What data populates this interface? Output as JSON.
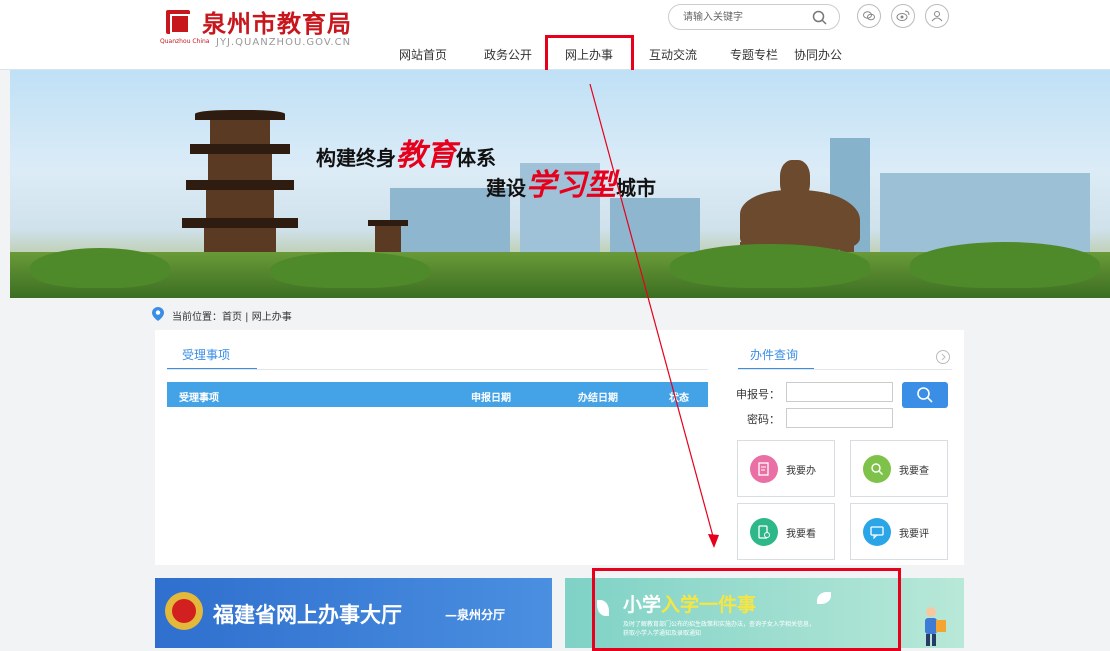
{
  "header": {
    "logo_sub": "Quanzhou China",
    "site_name": "泉州市教育局",
    "site_domain": "JYJ.QUANZHOU.GOV.CN",
    "search_placeholder": "请输入关键字",
    "social_icons": [
      "wechat-icon",
      "weibo-icon",
      "person-icon"
    ]
  },
  "nav": {
    "items": [
      {
        "label": "网站首页"
      },
      {
        "label": "政务公开"
      },
      {
        "label": "网上办事"
      },
      {
        "label": "互动交流"
      },
      {
        "label": "专题专栏"
      },
      {
        "label": "协同办公"
      }
    ],
    "active_index": 2
  },
  "banner": {
    "slogan1_a": "构建终身",
    "slogan1_red": "教育",
    "slogan1_b": "体系",
    "slogan2_a": "建设",
    "slogan2_red": "学习型",
    "slogan2_b": "城市"
  },
  "breadcrumb": {
    "text": "当前位置：首页 | 网上办事"
  },
  "left_panel": {
    "tab": "受理事项",
    "columns": [
      "受理事项",
      "申报日期",
      "办结日期",
      "状态"
    ]
  },
  "right_panel": {
    "tab": "办件查询",
    "labels": {
      "number": "申报号：",
      "password": "密码："
    },
    "tiles": [
      {
        "label": "我要办",
        "color": "#e96fa4",
        "icon": "edit-icon"
      },
      {
        "label": "我要查",
        "color": "#7ec24a",
        "icon": "search-icon"
      },
      {
        "label": "我要看",
        "color": "#2eb88a",
        "icon": "phone-view-icon"
      },
      {
        "label": "我要评",
        "color": "#2aa6e8",
        "icon": "comment-icon"
      }
    ]
  },
  "bottom": {
    "left_title": "福建省网上办事大厅",
    "left_sub": "—泉州分厅",
    "right_title_1": "小学",
    "right_title_2": "入学一件事",
    "right_desc_1": "及时了解教育部门公布的招生政策和实施办法，查询子女入学相关信息，",
    "right_desc_2": "获取小学入学通知及录取通知"
  },
  "colors": {
    "brand_red": "#c8161d",
    "accent_blue": "#3a8ee6",
    "annotation_red": "#e6001c"
  }
}
